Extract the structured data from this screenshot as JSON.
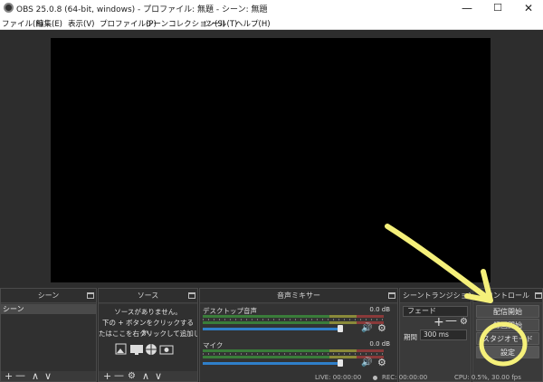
{
  "window": {
    "title": "OBS 25.0.8 (64-bit, windows) - プロファイル: 無題 - シーン: 無題",
    "minimize": "—",
    "maximize": "☐",
    "close": "✕"
  },
  "menu": [
    "ファイル(F)",
    "編集(E)",
    "表示(V)",
    "プロファイル(P)",
    "シーンコレクション(S)",
    "ツール(T)",
    "ヘルプ(H)"
  ],
  "scenes": {
    "title": "シーン",
    "items": [
      "シーン"
    ],
    "tools": [
      "+",
      "—",
      "∧",
      "∨"
    ]
  },
  "sources": {
    "title": "ソース",
    "empty_line1": "ソースがありません。",
    "empty_line2": "下の + ボタンをクリックするか、",
    "empty_line3": "たはここを右クリックして追加してくださ",
    "tools": [
      "+",
      "—",
      "⚙",
      "∧",
      "∨"
    ]
  },
  "mixer": {
    "title": "音声ミキサー",
    "channels": [
      {
        "name": "デスクトップ音声",
        "db": "0.0 dB",
        "volume": 0.95
      },
      {
        "name": "マイク",
        "db": "0.0 dB",
        "volume": 0.95
      }
    ]
  },
  "transitions": {
    "title": "シーントランジション",
    "type": "フェード",
    "duration_label": "期間",
    "duration_value": "300 ms"
  },
  "controls": {
    "title": "コントロール",
    "start_streaming": "配信開始",
    "start_recording": "録画開始",
    "studio_mode": "スタジオモード",
    "settings": "設定"
  },
  "status": {
    "live": "LIVE: 00:00:00",
    "rec": "REC: 00:00:00",
    "cpu": "CPU: 0.5%, 30.00 fps"
  },
  "annotation_color": "#f5f07a"
}
